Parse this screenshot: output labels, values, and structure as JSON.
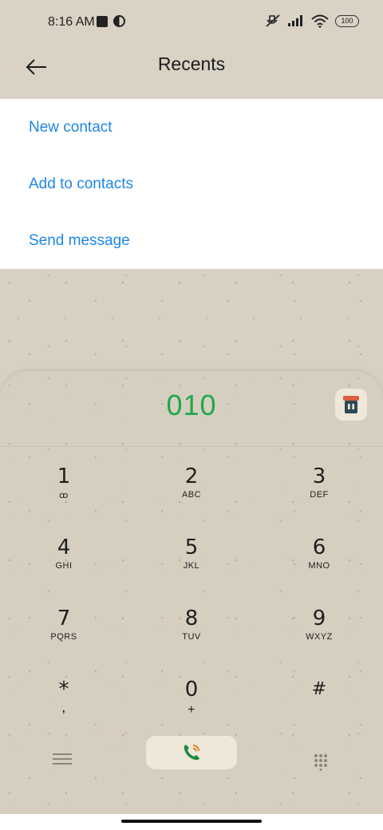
{
  "status_bar": {
    "time": "8:16 AM",
    "battery": "100",
    "icons": [
      "notification-square-icon",
      "circle-app-icon",
      "mute-icon",
      "signal-icon",
      "wifi-icon",
      "battery-icon"
    ]
  },
  "header": {
    "title": "Recents",
    "back_icon": "arrow-left-icon"
  },
  "menu": {
    "items": [
      {
        "label": "New contact"
      },
      {
        "label": "Add to contacts"
      },
      {
        "label": "Send message"
      }
    ],
    "color": "#1e87e5"
  },
  "dialer": {
    "number": "010",
    "number_color": "#1fa84a",
    "keys": [
      {
        "digit": "1",
        "letters": "ꝏ"
      },
      {
        "digit": "2",
        "letters": "ABC"
      },
      {
        "digit": "3",
        "letters": "DEF"
      },
      {
        "digit": "4",
        "letters": "GHI"
      },
      {
        "digit": "5",
        "letters": "JKL"
      },
      {
        "digit": "6",
        "letters": "MNO"
      },
      {
        "digit": "7",
        "letters": "PQRS"
      },
      {
        "digit": "8",
        "letters": "TUV"
      },
      {
        "digit": "9",
        "letters": "WXYZ"
      },
      {
        "digit": "*",
        "letters": ","
      },
      {
        "digit": "0",
        "letters": "+"
      },
      {
        "digit": "#",
        "letters": ""
      }
    ],
    "icons": [
      "shop-icon",
      "menu-icon",
      "call-icon",
      "keypad-icon"
    ]
  }
}
